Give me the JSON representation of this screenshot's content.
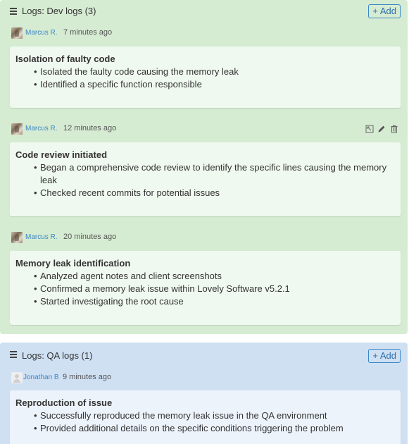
{
  "dev_logs": {
    "title": "Logs: Dev logs (3)",
    "add_label": "+ Add",
    "entries": [
      {
        "author": "Marcus R.",
        "time": "7 minutes ago",
        "title": "Isolation of faulty code",
        "bullets": [
          "Isolated the faulty code causing the memory leak",
          "Identified a specific function responsible"
        ]
      },
      {
        "author": "Marcus R.",
        "time": "12 minutes ago",
        "title": "Code review initiated",
        "bullets": [
          "Began a comprehensive code review to identify the specific lines causing the memory leak",
          "Checked recent commits for potential issues"
        ],
        "actions": [
          "expand-icon",
          "edit-pencil-icon",
          "delete-trash-icon"
        ]
      },
      {
        "author": "Marcus R.",
        "time": "20 minutes ago",
        "title": "Memory leak identification",
        "bullets": [
          "Analyzed agent notes and client screenshots",
          "Confirmed a memory leak issue within Lovely Software v5.2.1",
          "Started investigating the root cause"
        ]
      }
    ]
  },
  "qa_logs": {
    "title": "Logs: QA logs (1)",
    "add_label": "+ Add",
    "entries": [
      {
        "author": "Jonathan B",
        "time": "9 minutes ago",
        "title": "Reproduction of issue",
        "bullets": [
          "Successfully reproduced the memory leak issue in the QA environment",
          "Provided additional details on the specific conditions triggering the problem"
        ]
      }
    ]
  },
  "colors": {
    "dev_section_bg": "#d6ecd2",
    "qa_section_bg": "#cfe0f3",
    "link": "#3a86c6",
    "add_button_border": "#3a86c6"
  }
}
